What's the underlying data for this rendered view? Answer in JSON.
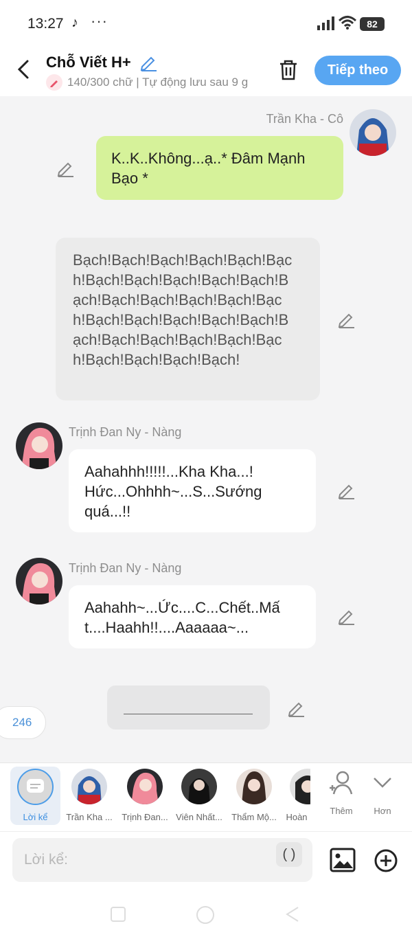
{
  "status": {
    "time": "13:27",
    "battery": "82"
  },
  "header": {
    "title": "Chỗ Viết H+",
    "subtitle": "140/300 chữ | Tự động lưu sau 9 g",
    "next_label": "Tiếp theo"
  },
  "messages": {
    "m1": {
      "sender": "Trần Kha - Cô",
      "text": "K..K..Không...ạ..* Đâm Mạnh Bạo *"
    },
    "narration": {
      "text": "Bạch!Bạch!Bạch!Bạch!Bạch!Bạch!Bạch!Bạch!Bạch!Bạch!Bạch!Bạch!Bạch!Bạch!Bạch!Bạch!Bạch!Bạch!Bạch!Bạch!Bạch!Bạch!Bạch!Bạch!Bạch!Bạch!Bạch!Bạch!Bạch!Bạch!Bạch!Bạch!"
    },
    "m2": {
      "sender": "Trịnh Đan Ny - Nàng",
      "text": "Aahahhh!!!!!...Kha Kha...! Hức...Ohhhh~...S...Sướng quá...!!"
    },
    "m3": {
      "sender": "Trịnh Đan Ny - Nàng",
      "text": "Aahahh~...Ức....C...Chết..Mất....Haahh!!....Aaaaaa~..."
    }
  },
  "word_count_badge": "246",
  "characters": [
    {
      "label": "Lời kể"
    },
    {
      "label": "Trần Kha ..."
    },
    {
      "label": "Trịnh Đan..."
    },
    {
      "label": "Viên Nhất..."
    },
    {
      "label": "Thẩm Mộ..."
    },
    {
      "label": "Hoàn"
    }
  ],
  "more": {
    "add_label": "Thêm",
    "more_label": "Hơn"
  },
  "input": {
    "placeholder": "Lời kể:",
    "paren": "( )"
  },
  "colors": {
    "accent": "#58a6f2",
    "green_bubble": "#d6f29a",
    "narration_bubble": "#ebebeb"
  }
}
